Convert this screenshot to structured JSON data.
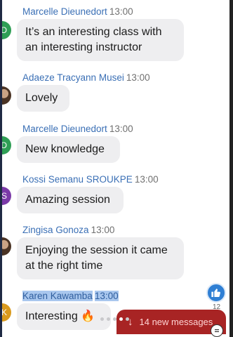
{
  "messages": [
    {
      "avatar": "ID",
      "avatar_color": "#2e9e55",
      "name": "Marcelle Dieunedort",
      "time": "13:00",
      "lines": [
        "It’s an interesting class with",
        "an interesting instructor"
      ]
    },
    {
      "avatar": "",
      "avatar_color": "#4a3324",
      "name": "Adaeze Tracyann Musei",
      "time": "13:00",
      "lines": [
        "Lovely"
      ]
    },
    {
      "avatar": "ID",
      "avatar_color": "#2e9e55",
      "name": "Marcelle Dieunedort",
      "time": "13:00",
      "lines": [
        "New knowledge"
      ]
    },
    {
      "avatar": "KS",
      "avatar_color": "#7b3aa8",
      "name": "Kossi Semanu SROUKPE",
      "time": "13:00",
      "lines": [
        "Amazing session"
      ]
    },
    {
      "avatar": "",
      "avatar_color": "#4a3324",
      "name": "Zingisa Gonoza",
      "time": "13:00",
      "lines": [
        "Enjoying the session it came",
        "at the right time"
      ]
    },
    {
      "avatar": "KK",
      "avatar_color": "#d99a1e",
      "name": "Karen Kawamba",
      "time": "13:00",
      "lines": [
        "Interesting 🔥"
      ]
    }
  ],
  "new_messages": {
    "label": "14 new messages"
  },
  "likes": {
    "count": "12",
    "icon": "thumbs-up-icon"
  },
  "colors": {
    "name": "#3a6fb5",
    "bubble": "#eeeef0",
    "banner": "#a82424",
    "like": "#2f7fd4"
  }
}
